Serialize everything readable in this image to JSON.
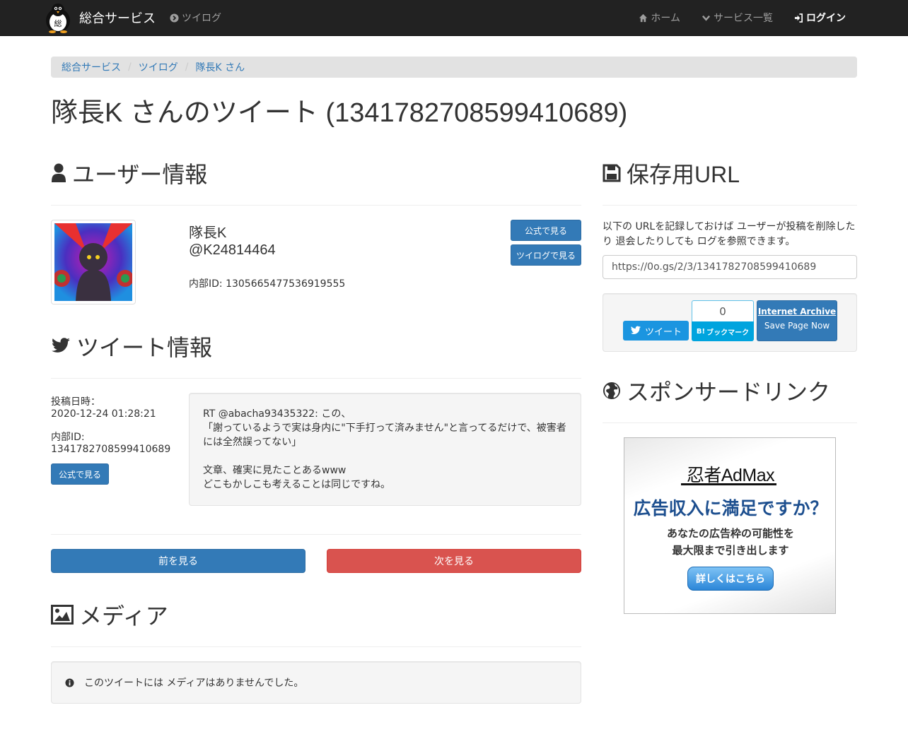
{
  "nav": {
    "brand": "総合サービス",
    "left_link": "ツイログ",
    "home": "ホーム",
    "services": "サービス一覧",
    "login": "ログイン"
  },
  "breadcrumb": [
    "総合サービス",
    "ツイログ",
    "隊長K さん"
  ],
  "page_title": "隊長K さんのツイート (1341782708599410689)",
  "user": {
    "heading": "ユーザー情報",
    "name": "隊長K",
    "handle": "@K24814464",
    "internal_id": "内部ID: 1305665477536919555",
    "btn_official": "公式で見る",
    "btn_twilog": "ツイログで見る"
  },
  "tweet": {
    "heading": "ツイート情報",
    "posted_label": "投稿日時：",
    "posted_value": "2020-12-24 01:28:21",
    "id_label": "内部ID:",
    "id_value": "1341782708599410689",
    "btn_official": "公式で見る",
    "text_lines": [
      "RT @abacha93435322: この、",
      "「謝っているようで実は身内に\"下手打って済みません\"と言ってるだけで、被害者",
      "には全然誤ってない」",
      "",
      "文章、確実に見たことあるwww",
      "どこもかしこも考えることは同じですね。"
    ]
  },
  "pager": {
    "prev": "前を見る",
    "next": "次を見る"
  },
  "media": {
    "heading": "メディア",
    "empty_msg": "このツイートには メディアはありませんでした。"
  },
  "save": {
    "heading": "保存用URL",
    "desc_line1": "以下の URLを記録しておけば ユーザーが投稿を削除した",
    "desc_line2": "り 退会したりしても ログを参照できます。",
    "url": "https://0o.gs/2/3/1341782708599410689",
    "tweet_btn": "ツイート",
    "hatena_count": "0",
    "hatena_label": "ブックマーク",
    "archive_title": "Internet Archive",
    "archive_sub": "Save Page Now"
  },
  "sponsor": {
    "heading": "スポンサードリンク",
    "ad_brand": "忍者AdMax",
    "ad_headline": "広告収入に満足ですか？",
    "ad_line1": "あなたの広告枠の可能性を",
    "ad_line2": "最大限まで引き出します",
    "ad_button": "詳しくはこちら"
  },
  "colors": {
    "primary": "#337ab7",
    "danger": "#d9534f",
    "navbar": "#222222",
    "twitter": "#1b95e0",
    "hatena": "#00a4de"
  }
}
